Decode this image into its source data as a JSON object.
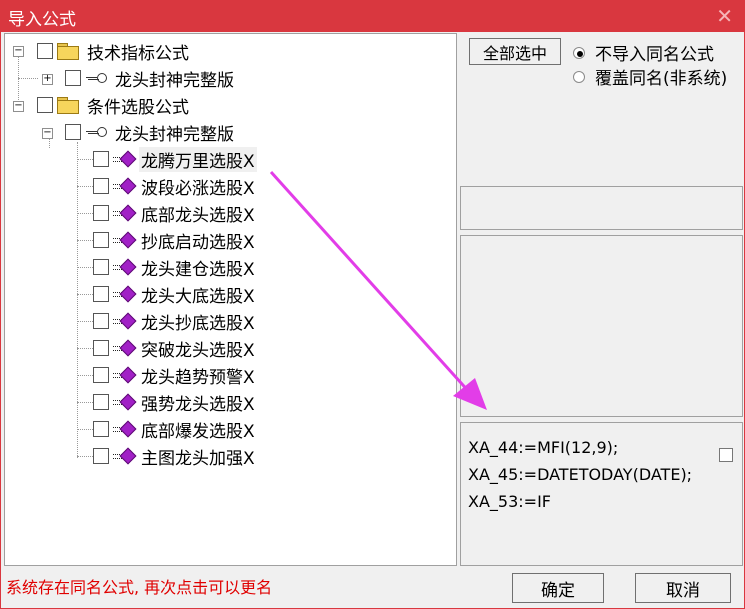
{
  "window": {
    "title": "导入公式"
  },
  "tree": {
    "groups": [
      {
        "label": "技术指标公式",
        "sub_label": "龙头封神完整版"
      },
      {
        "label": "条件选股公式",
        "sub_label": "龙头封神完整版"
      }
    ],
    "formulas": [
      "龙腾万里选股X",
      "波段必涨选股X",
      "底部龙头选股X",
      "抄底启动选股X",
      "龙头建仓选股X",
      "龙头大底选股X",
      "龙头抄底选股X",
      "突破龙头选股X",
      "龙头趋势预警X",
      "强势龙头选股X",
      "底部爆发选股X",
      "主图龙头加强X"
    ],
    "selected_formula": "龙腾万里选股X"
  },
  "options": {
    "select_all_label": "全部选中",
    "radio_skip_label": "不导入同名公式",
    "radio_overwrite_label": "覆盖同名(非系统)",
    "selected": "skip"
  },
  "formula_preview": {
    "lines": [
      "XA_44:=MFI(12,9);",
      "XA_45:=DATETODAY(DATE);",
      "XA_53:=IF"
    ]
  },
  "status_text": "系统存在同名公式, 再次点击可以更名",
  "buttons": {
    "ok": "确定",
    "cancel": "取消"
  },
  "colors": {
    "title_bar": "#d9373f",
    "status_text": "#e00000",
    "annotation_arrow": "#e23de8",
    "formula_icon": "#a120c6"
  }
}
